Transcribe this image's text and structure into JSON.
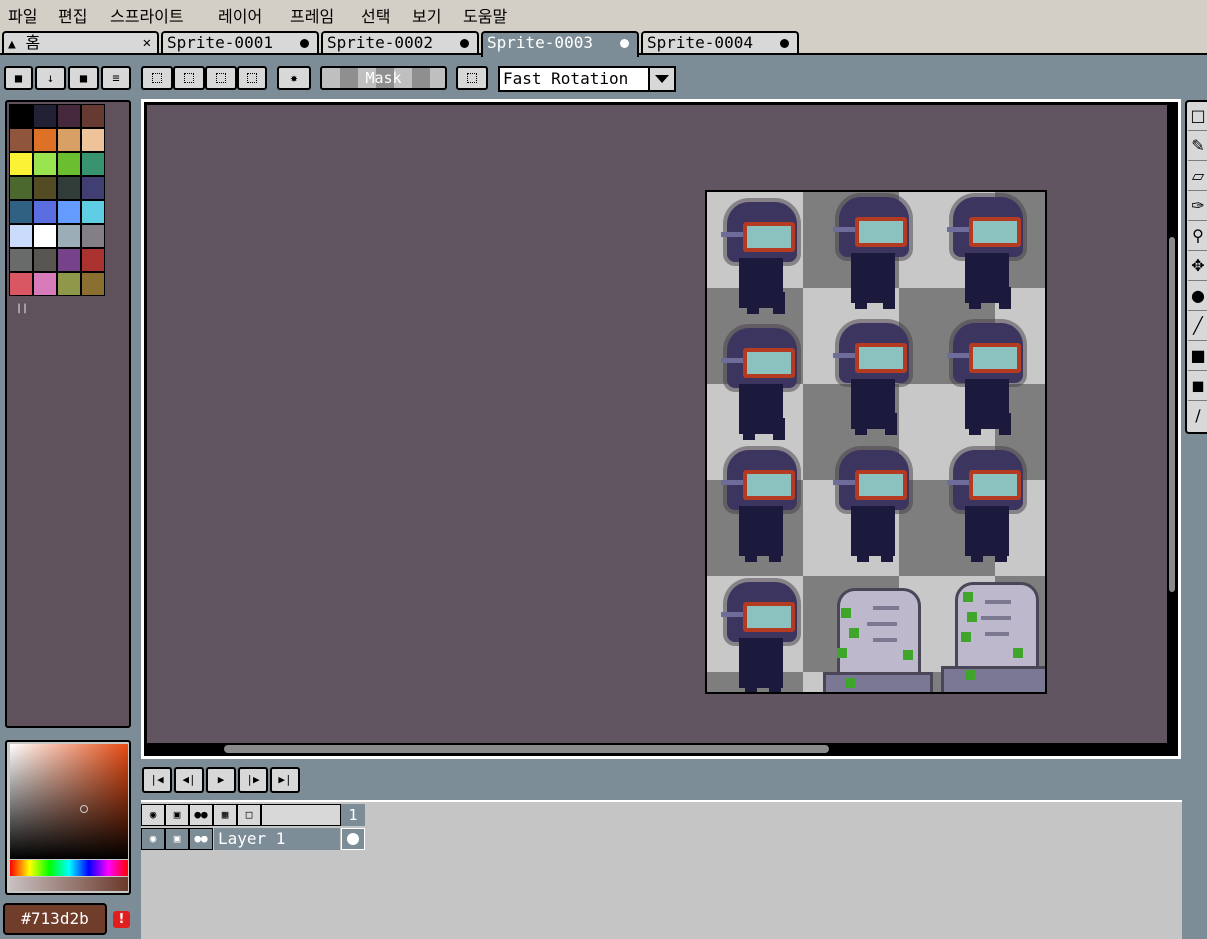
{
  "menu": [
    "파일",
    "편집",
    "스프라이트",
    "레이어",
    "프레임",
    "선택",
    "보기",
    "도움말"
  ],
  "tabs": [
    {
      "label": "홈",
      "icon": "home-icon",
      "closable": true
    },
    {
      "label": "Sprite-0001",
      "modified": true
    },
    {
      "label": "Sprite-0002",
      "modified": true
    },
    {
      "label": "Sprite-0003",
      "modified": true,
      "active": true
    },
    {
      "label": "Sprite-0004",
      "modified": true
    }
  ],
  "toolbar": {
    "mask_label": "Mask",
    "rotation_algorithm": "Fast Rotation"
  },
  "palette": {
    "colors": [
      "#000000",
      "#222034",
      "#45283c",
      "#663931",
      "#8f563b",
      "#df7126",
      "#d9a066",
      "#eec39a",
      "#fbf236",
      "#99e550",
      "#6abe30",
      "#37946e",
      "#4b692f",
      "#524b24",
      "#323c39",
      "#3f3f74",
      "#306082",
      "#5b6ee1",
      "#639bff",
      "#5fcde4",
      "#cbdbfc",
      "#ffffff",
      "#9badb7",
      "#847e87",
      "#696a6a",
      "#595652",
      "#76428a",
      "#ac3232",
      "#d95763",
      "#d77bba",
      "#8f974a",
      "#8a6f30"
    ]
  },
  "color": {
    "hex": "#713d2b",
    "hue_color": "#e64a12"
  },
  "timeline": {
    "frame_number": "1",
    "layer_name": "Layer 1"
  },
  "colors": {
    "workspace_bg": "#625562",
    "accent": "#7d8d98"
  }
}
